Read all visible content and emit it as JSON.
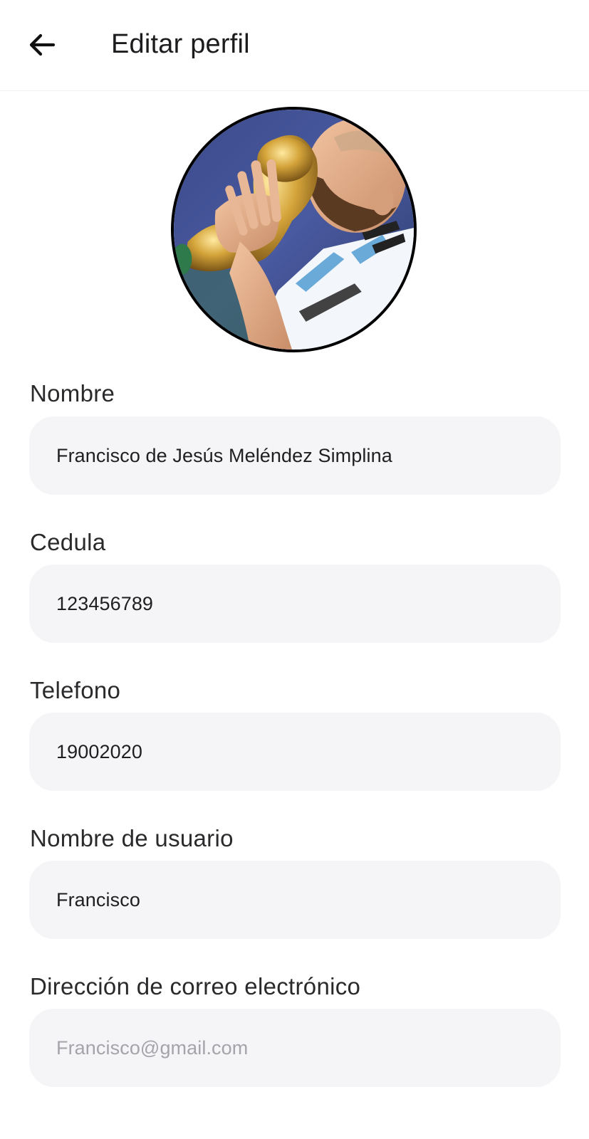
{
  "header": {
    "title": "Editar perfil",
    "back_icon": "arrow-left-icon"
  },
  "profile": {
    "avatar_icon": "profile-photo"
  },
  "form": {
    "fields": [
      {
        "label": "Nombre",
        "value": "Francisco de Jesús Meléndez Simplina"
      },
      {
        "label": "Cedula",
        "value": "123456789"
      },
      {
        "label": "Telefono",
        "value": "19002020"
      },
      {
        "label": "Nombre de usuario",
        "value": "Francisco"
      },
      {
        "label": "Dirección de correo electrónico",
        "placeholder": "Francisco@gmail.com"
      }
    ]
  },
  "colors": {
    "field_background": "#f5f5f7",
    "placeholder_text": "#a4a4aa",
    "avatar_border": "#000000"
  }
}
